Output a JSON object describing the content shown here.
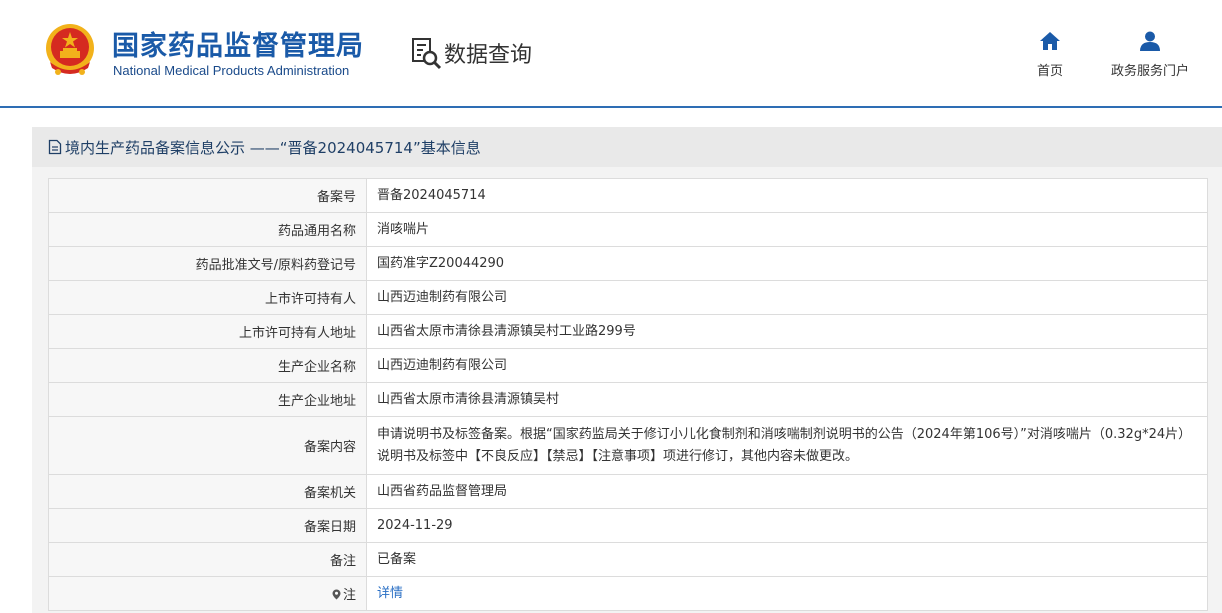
{
  "header": {
    "org_name_cn": "国家药品监督管理局",
    "org_name_en": "National Medical Products Administration",
    "section_name": "数据查询",
    "nav": [
      {
        "label": "首页",
        "icon": "home-icon"
      },
      {
        "label": "政务服务门户",
        "icon": "user-icon"
      }
    ]
  },
  "page": {
    "title": "境内生产药品备案信息公示 ——“晋备2024045714”基本信息"
  },
  "record": {
    "rows": [
      {
        "label": "备案号",
        "value": "晋备2024045714"
      },
      {
        "label": "药品通用名称",
        "value": "消咳喘片"
      },
      {
        "label": "药品批准文号/原料药登记号",
        "value": "国药准字Z20044290"
      },
      {
        "label": "上市许可持有人",
        "value": "山西迈迪制药有限公司"
      },
      {
        "label": "上市许可持有人地址",
        "value": "山西省太原市清徐县清源镇吴村工业路299号"
      },
      {
        "label": "生产企业名称",
        "value": "山西迈迪制药有限公司"
      },
      {
        "label": "生产企业地址",
        "value": "山西省太原市清徐县清源镇吴村"
      },
      {
        "label": "备案内容",
        "value": "申请说明书及标签备案。根据“国家药监局关于修订小儿化食制剂和消咳喘制剂说明书的公告（2024年第106号）”对消咳喘片（0.32g*24片）说明书及标签中【不良反应】【禁忌】【注意事项】项进行修订，其他内容未做更改。"
      },
      {
        "label": "备案机关",
        "value": "山西省药品监督管理局"
      },
      {
        "label": "备案日期",
        "value": "2024-11-29"
      },
      {
        "label": "备注",
        "value": "已备案"
      }
    ],
    "note_row": {
      "label": "注",
      "link_text": "详情",
      "icon": "pin-icon"
    }
  },
  "colors": {
    "brand_blue": "#1a5aa8",
    "link_blue": "#2a6fc4",
    "emblem_red": "#d52a20",
    "emblem_gold": "#f2b21b"
  }
}
